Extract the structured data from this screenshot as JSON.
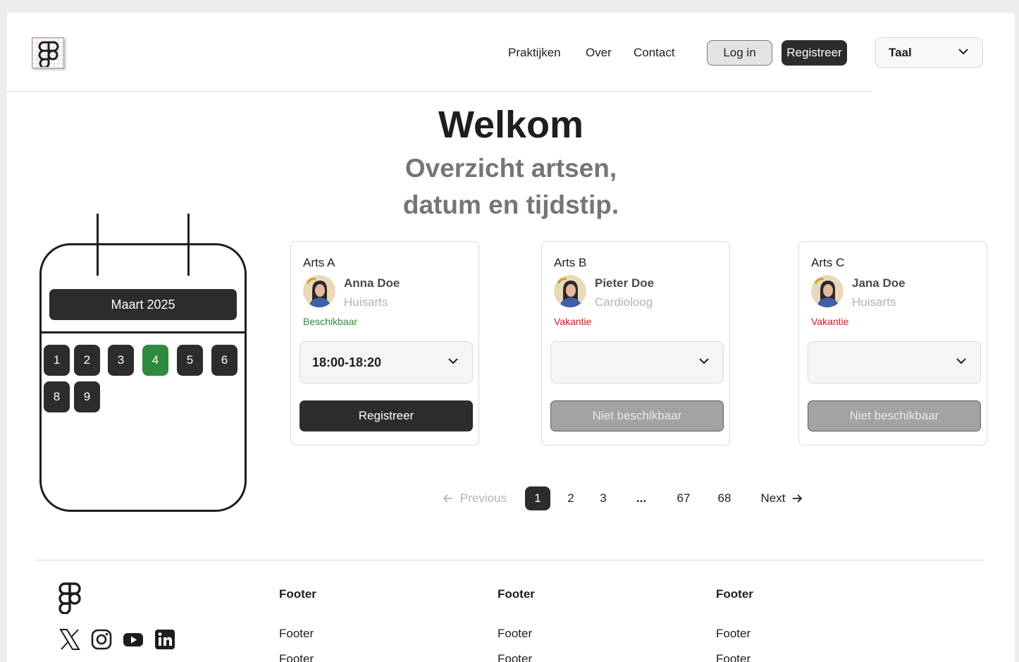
{
  "header": {
    "nav": [
      "Praktijken",
      "Over",
      "Contact"
    ],
    "login_label": "Log in",
    "register_label": "Registreer",
    "language_label": "Taal"
  },
  "hero": {
    "title": "Welkom",
    "subtitle_line1": "Overzicht artsen,",
    "subtitle_line2": "datum en tijdstip."
  },
  "calendar": {
    "month_label": "Maart 2025",
    "days": [
      "1",
      "2",
      "3",
      "4",
      "5",
      "6",
      "8",
      "9"
    ],
    "selected_day": "4"
  },
  "doctors": [
    {
      "title": "Arts A",
      "name": "Anna Doe",
      "specialty": "Huisarts",
      "status": "Beschikbaar",
      "time_slot": "18:00-18:20",
      "action_label": "Registreer"
    },
    {
      "title": "Arts B",
      "name": "Pieter Doe",
      "specialty": "Cardioloog",
      "status": "Vakantie",
      "time_slot": "",
      "action_label": "Niet beschikbaar"
    },
    {
      "title": "Arts C",
      "name": "Jana Doe",
      "specialty": "Huisarts",
      "status": "Vakantie",
      "time_slot": "",
      "action_label": "Niet beschikbaar"
    }
  ],
  "pagination": {
    "previous_label": "Previous",
    "pages": [
      "1",
      "2",
      "3",
      "...",
      "67",
      "68"
    ],
    "current_page": "1",
    "next_label": "Next"
  },
  "footer": {
    "columns": [
      {
        "heading": "Footer",
        "links": [
          "Footer",
          "Footer"
        ]
      },
      {
        "heading": "Footer",
        "links": [
          "Footer",
          "Footer"
        ]
      },
      {
        "heading": "Footer",
        "links": [
          "Footer",
          "Footer"
        ]
      }
    ],
    "social_icons": [
      "x-icon",
      "instagram-icon",
      "youtube-icon",
      "linkedin-icon"
    ]
  },
  "colors": {
    "available": "#2e8b3e",
    "unavailable": "#d01c1c",
    "primary": "#2c2c2c"
  }
}
